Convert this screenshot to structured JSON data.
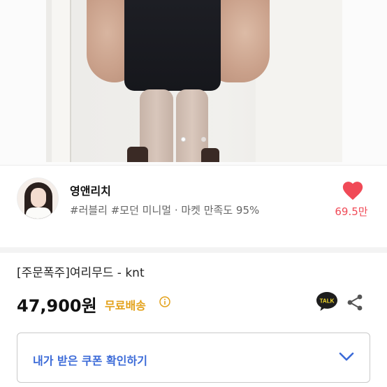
{
  "gallery": {
    "dot_count": 2,
    "active_index": 0
  },
  "shop": {
    "name": "영앤리치",
    "tags": "#러블리 #모던 미니멀 · 마켓 만족도 95%",
    "likes": "69.5만",
    "heart_color": "#f04a57"
  },
  "product": {
    "title": "[주문폭주]여리무드 - knt",
    "price": "47,900원",
    "shipping": "무료배송",
    "shipping_color": "#e3a11a"
  },
  "actions": {
    "talk_icon": "talk-chat-icon",
    "talk_label": "TALK",
    "share_icon": "share-icon"
  },
  "coupon": {
    "label": "내가 받은 쿠폰 확인하기",
    "accent": "#3c6bd8"
  }
}
